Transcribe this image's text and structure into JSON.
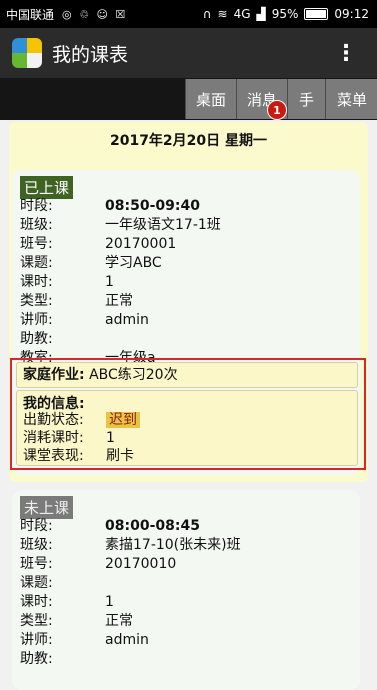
{
  "status_bar": {
    "carrier": "中国联通",
    "network": "4G",
    "battery": "95%",
    "time": "09:12",
    "battery_level": 0.95
  },
  "app": {
    "title": "我的课表"
  },
  "toolbar": {
    "desk": "桌面",
    "msg": "消息",
    "hand": "手",
    "menu": "菜单",
    "badge": "1"
  },
  "day": {
    "date": "2017年2月20日 星期一"
  },
  "lessons": [
    {
      "status": "已上课",
      "rows": [
        {
          "label": "时段:",
          "value": "08:50-09:40"
        },
        {
          "label": "班级:",
          "value": "一年级语文17-1班"
        },
        {
          "label": "班号:",
          "value": "20170001"
        },
        {
          "label": "课题:",
          "value": "学习ABC"
        },
        {
          "label": "课时:",
          "value": "1"
        },
        {
          "label": "类型:",
          "value": "正常"
        },
        {
          "label": "讲师:",
          "value": "admin"
        },
        {
          "label": "助教:",
          "value": ""
        },
        {
          "label": "教室:",
          "value": "一年级a"
        }
      ],
      "homework": {
        "label": "家庭作业:",
        "value": "ABC练习20次"
      },
      "my_info": {
        "title": "我的信息:",
        "rows": [
          {
            "label": "出勤状态:",
            "value": "迟到"
          },
          {
            "label": "消耗课时:",
            "value": "1"
          },
          {
            "label": "课堂表现:",
            "value": "刷卡"
          }
        ]
      }
    },
    {
      "status": "未上课",
      "rows": [
        {
          "label": "时段:",
          "value": "08:00-08:45"
        },
        {
          "label": "班级:",
          "value": "素描17-10(张未来)班"
        },
        {
          "label": "班号:",
          "value": "20170010"
        },
        {
          "label": "课题:",
          "value": ""
        },
        {
          "label": "课时:",
          "value": "1"
        },
        {
          "label": "类型:",
          "value": "正常"
        },
        {
          "label": "讲师:",
          "value": "admin"
        },
        {
          "label": "助教:",
          "value": ""
        }
      ]
    }
  ]
}
